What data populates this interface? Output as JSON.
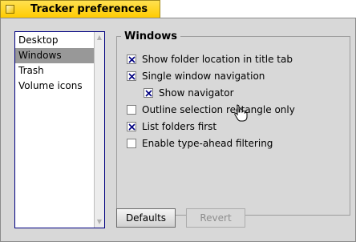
{
  "window": {
    "title": "Tracker preferences"
  },
  "sidebar": {
    "items": [
      {
        "label": "Desktop",
        "selected": false
      },
      {
        "label": "Windows",
        "selected": true
      },
      {
        "label": "Trash",
        "selected": false
      },
      {
        "label": "Volume icons",
        "selected": false
      }
    ]
  },
  "group": {
    "title": "Windows",
    "options": [
      {
        "label": "Show folder location in title tab",
        "checked": true
      },
      {
        "label": "Single window navigation",
        "checked": true
      },
      {
        "label": "Show navigator",
        "checked": true
      },
      {
        "label": "Outline selection rectangle only",
        "checked": false
      },
      {
        "label": "List folders first",
        "checked": true
      },
      {
        "label": "Enable type-ahead filtering",
        "checked": false
      }
    ]
  },
  "buttons": {
    "defaults": "Defaults",
    "revert": "Revert"
  },
  "colors": {
    "tab": "#ffcb00",
    "panel": "#d8d8d8",
    "list_border": "#000080",
    "selection": "#989898"
  }
}
